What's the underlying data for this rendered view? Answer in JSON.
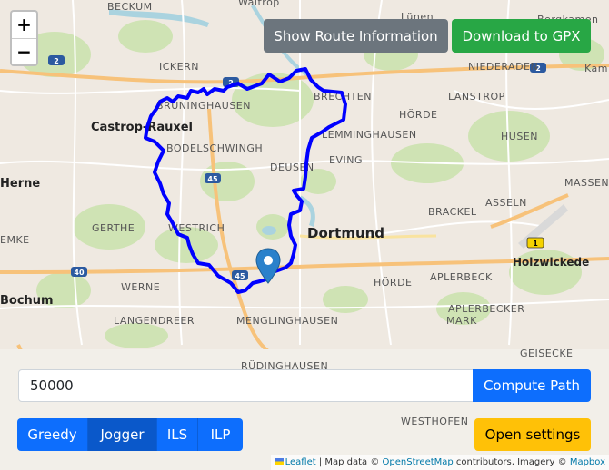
{
  "map": {
    "zoom_in": "+",
    "zoom_out": "−",
    "labels": {
      "waltrop": "Waltrop",
      "beckum": "BECKUM",
      "lunen": "Lünen",
      "bergkamen": "Bergkamen",
      "ickern": "ICKERN",
      "niederaden": "NIEDERADEN",
      "kamen": "Kam",
      "castrop_rauxel": "Castrop-Rauxel",
      "bruninghausen": "BRÜNINGHAUSEN",
      "brechten": "BRECHTEN",
      "lanstrop": "LANSTROP",
      "horde_top": "HÖRDE",
      "husen": "HUSEN",
      "bodelschwingh": "BODELSCHWINGH",
      "eving": "EVING",
      "lemminghausen": "LEMMINGHAUSEN",
      "herne": "Herne",
      "deusen": "DEUSEN",
      "massen": "MASSEN",
      "gerthe": "GERTHE",
      "brackel": "BRACKEL",
      "asseln": "ASSELN",
      "westrich": "WESTRICH",
      "dortmund": "Dortmund",
      "emke": "EMKE",
      "holzwickede": "Holzwickede",
      "bochum": "Bochum",
      "werne": "WERNE",
      "horde": "HÖRDE",
      "aplerbeck": "APLERBECK",
      "langendreer": "LANGENDREER",
      "aplerbecker_mark": "APLERBECKER",
      "mark": "MARK",
      "menglinghausen": "MENGLINGHAUSEN",
      "geisecke": "GEISECKE",
      "rudinghausen": "RÜDINGHAUSEN",
      "westhofen": "WESTHOFEN"
    },
    "road_shields": {
      "a2_left": "2",
      "a2_center": "2",
      "a2_right": "2",
      "a45_top": "45",
      "a45_bottom": "45",
      "a40": "40",
      "b1": "1"
    },
    "route_color": "#0000ff"
  },
  "buttons": {
    "route_info": "Show Route Information",
    "gpx": "Download to GPX",
    "compute": "Compute Path",
    "settings": "Open settings"
  },
  "distance_input": {
    "value": "50000"
  },
  "algorithms": [
    {
      "label": "Greedy",
      "active": false
    },
    {
      "label": "Jogger",
      "active": true
    },
    {
      "label": "ILS",
      "active": false
    },
    {
      "label": "ILP",
      "active": false
    }
  ],
  "attribution": {
    "leaflet": "Leaflet",
    "map_data": " | Map data © ",
    "osm": "OpenStreetMap",
    "contributors": " contributors, Imagery © ",
    "mapbox": "Mapbox"
  },
  "colors": {
    "secondary": "#6c757d",
    "success": "#28a745",
    "primary": "#0d6efd",
    "primary_active": "#0a58ca",
    "warning": "#ffc107"
  }
}
